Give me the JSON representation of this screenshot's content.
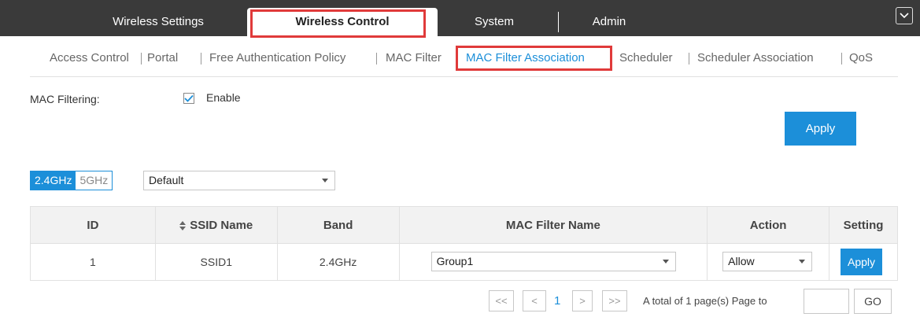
{
  "topnav": {
    "tabs": [
      {
        "label": "Wireless Settings",
        "active": false
      },
      {
        "label": "Wireless Control",
        "active": true
      },
      {
        "label": "System",
        "active": false
      },
      {
        "label": "Admin",
        "active": false
      }
    ],
    "menu_icon": "chevron-down-icon"
  },
  "subnav": {
    "items": [
      {
        "label": "Access Control",
        "active": false
      },
      {
        "label": "Portal",
        "active": false
      },
      {
        "label": "Free Authentication Policy",
        "active": false
      },
      {
        "label": "MAC Filter",
        "active": false
      },
      {
        "label": "MAC Filter Association",
        "active": true
      },
      {
        "label": "Scheduler",
        "active": false
      },
      {
        "label": "Scheduler Association",
        "active": false
      },
      {
        "label": "QoS",
        "active": false
      }
    ]
  },
  "mac_filtering": {
    "label": "MAC Filtering:",
    "checked": true,
    "checkbox_label": "Enable",
    "apply_label": "Apply"
  },
  "band_toggle": {
    "options": [
      "2.4GHz",
      "5GHz"
    ],
    "selected": "2.4GHz"
  },
  "ssid_select": {
    "value": "Default"
  },
  "table": {
    "headers": [
      "ID",
      "SSID Name",
      "Band",
      "MAC Filter Name",
      "Action",
      "Setting"
    ],
    "rows": [
      {
        "id": "1",
        "ssid": "SSID1",
        "band": "2.4GHz",
        "mac_filter": "Group1",
        "action": "Allow",
        "setting": "Apply"
      }
    ]
  },
  "pagination": {
    "first": "<<",
    "prev": "<",
    "current_page": "1",
    "next": ">",
    "last": ">>",
    "summary": "A total of 1 page(s)  Page to",
    "go_label": "GO"
  },
  "colors": {
    "accent": "#1c8fd9",
    "highlight": "#e03a3a",
    "nav_bg": "#3a3a3a"
  }
}
